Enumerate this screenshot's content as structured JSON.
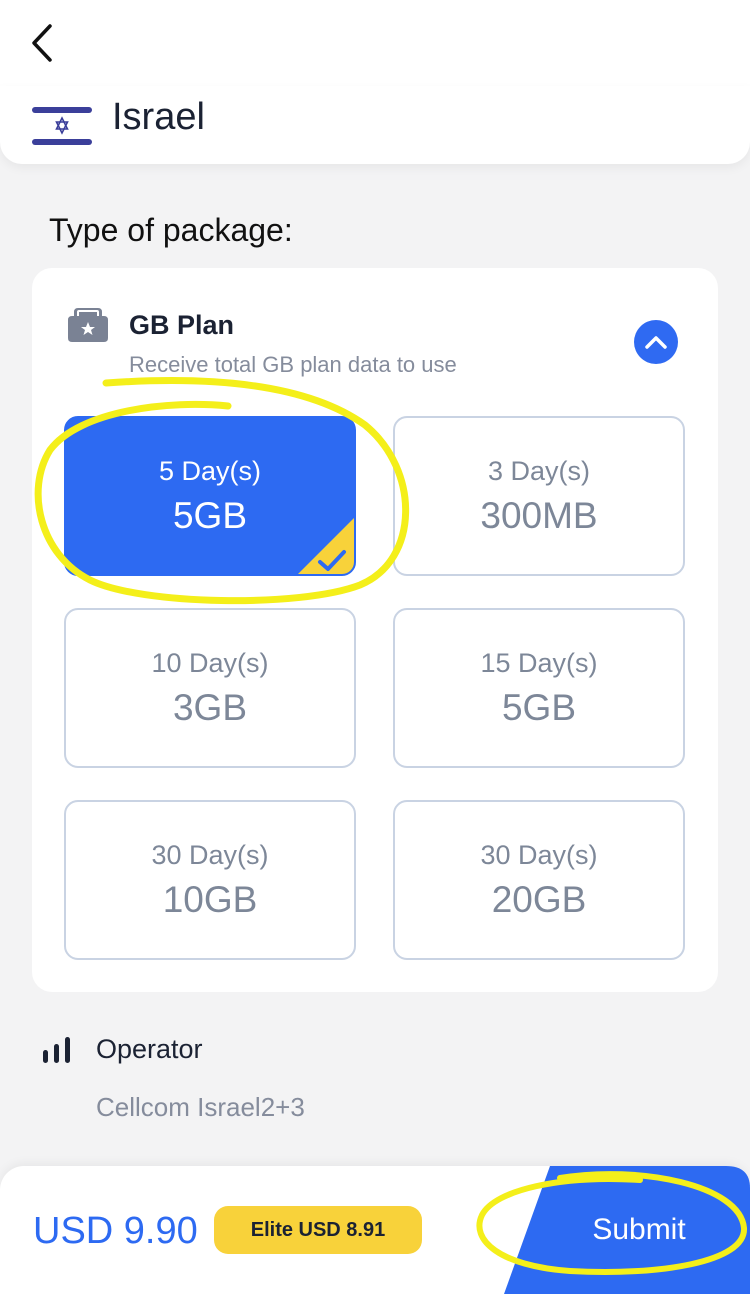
{
  "header": {
    "back_icon": "chevron-left-icon",
    "country": "Israel",
    "flag_icon": "israel-flag-icon"
  },
  "package_section": {
    "title": "Type of package:"
  },
  "plan": {
    "icon": "sim-star-icon",
    "title": "GB Plan",
    "subtitle": "Receive total GB plan data to use",
    "collapse_icon": "chevron-up-icon",
    "packages": [
      {
        "days": "5 Day(s)",
        "amount": "5GB",
        "selected": true
      },
      {
        "days": "3 Day(s)",
        "amount": "300MB",
        "selected": false
      },
      {
        "days": "10 Day(s)",
        "amount": "3GB",
        "selected": false
      },
      {
        "days": "15 Day(s)",
        "amount": "5GB",
        "selected": false
      },
      {
        "days": "30 Day(s)",
        "amount": "10GB",
        "selected": false
      },
      {
        "days": "30 Day(s)",
        "amount": "20GB",
        "selected": false
      }
    ]
  },
  "operator": {
    "icon": "signal-bars-icon",
    "label": "Operator",
    "value": "Cellcom Israel2+3"
  },
  "footer": {
    "price": "USD 9.90",
    "elite_price": "Elite USD 8.91",
    "submit_label": "Submit"
  },
  "colors": {
    "accent": "#2d6af2",
    "badge": "#f8d23a",
    "highlight": "#f4ef1a"
  }
}
